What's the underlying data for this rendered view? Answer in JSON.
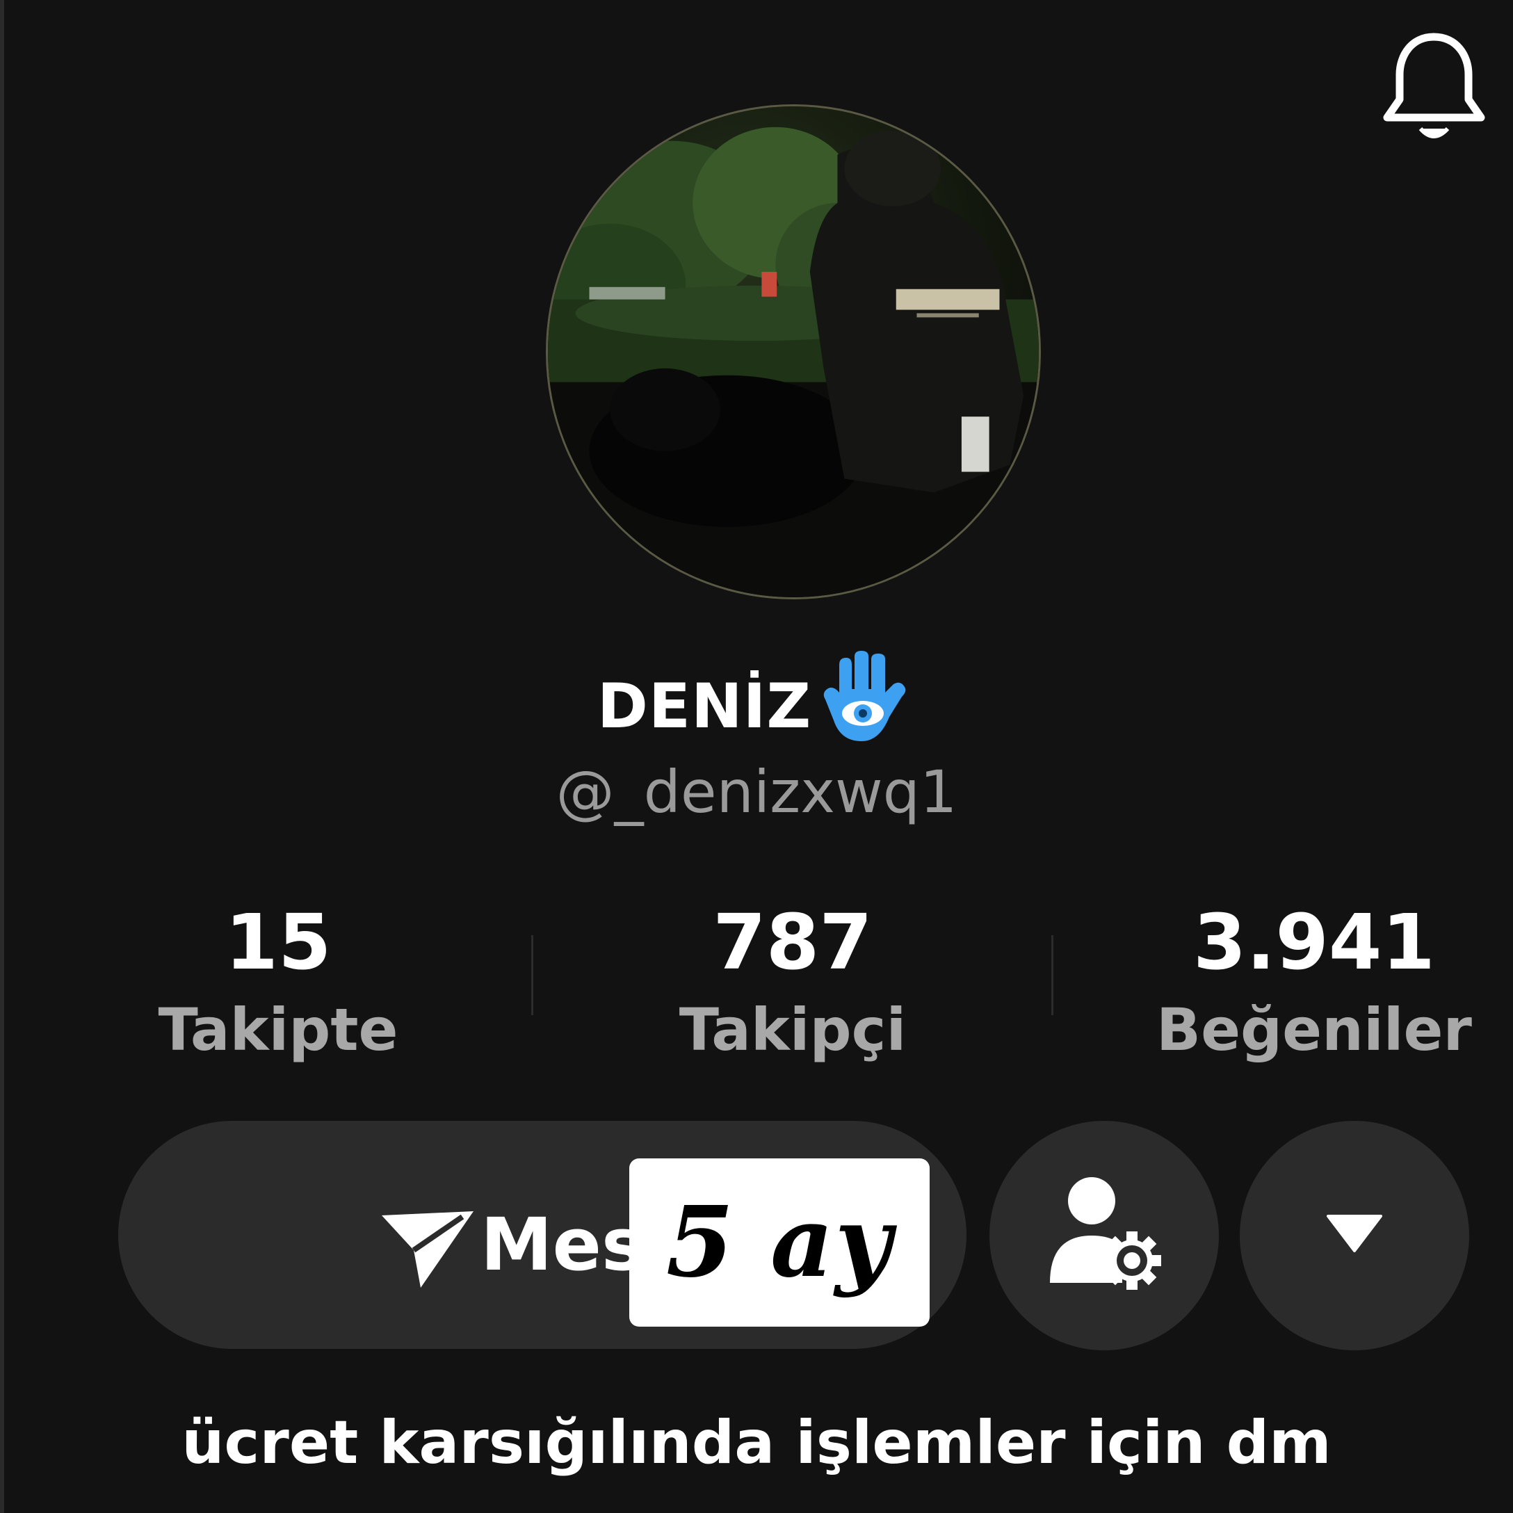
{
  "header": {
    "notification_icon": "bell-icon"
  },
  "profile": {
    "display_name": "DENİZ",
    "name_emoji_icon": "hamsa-icon",
    "username": "@_denizxwq1",
    "avatar_icon": "profile-photo"
  },
  "stats": [
    {
      "value": "15",
      "label": "Takipte"
    },
    {
      "value": "787",
      "label": "Takipçi"
    },
    {
      "value": "3.941",
      "label": "Beğeniler"
    }
  ],
  "actions": {
    "message_label": "Mes",
    "message_icon": "send-icon",
    "follow_settings_icon": "user-settings-icon",
    "more_icon": "caret-down-icon"
  },
  "overlay": {
    "text": "5 ay"
  },
  "bio": "ücret karsığılında işlemler için dm",
  "colors": {
    "background": "#121212",
    "button": "#2b2b2b",
    "muted_text": "#9a9a9a",
    "hamsa_blue": "#3ea0f0"
  }
}
